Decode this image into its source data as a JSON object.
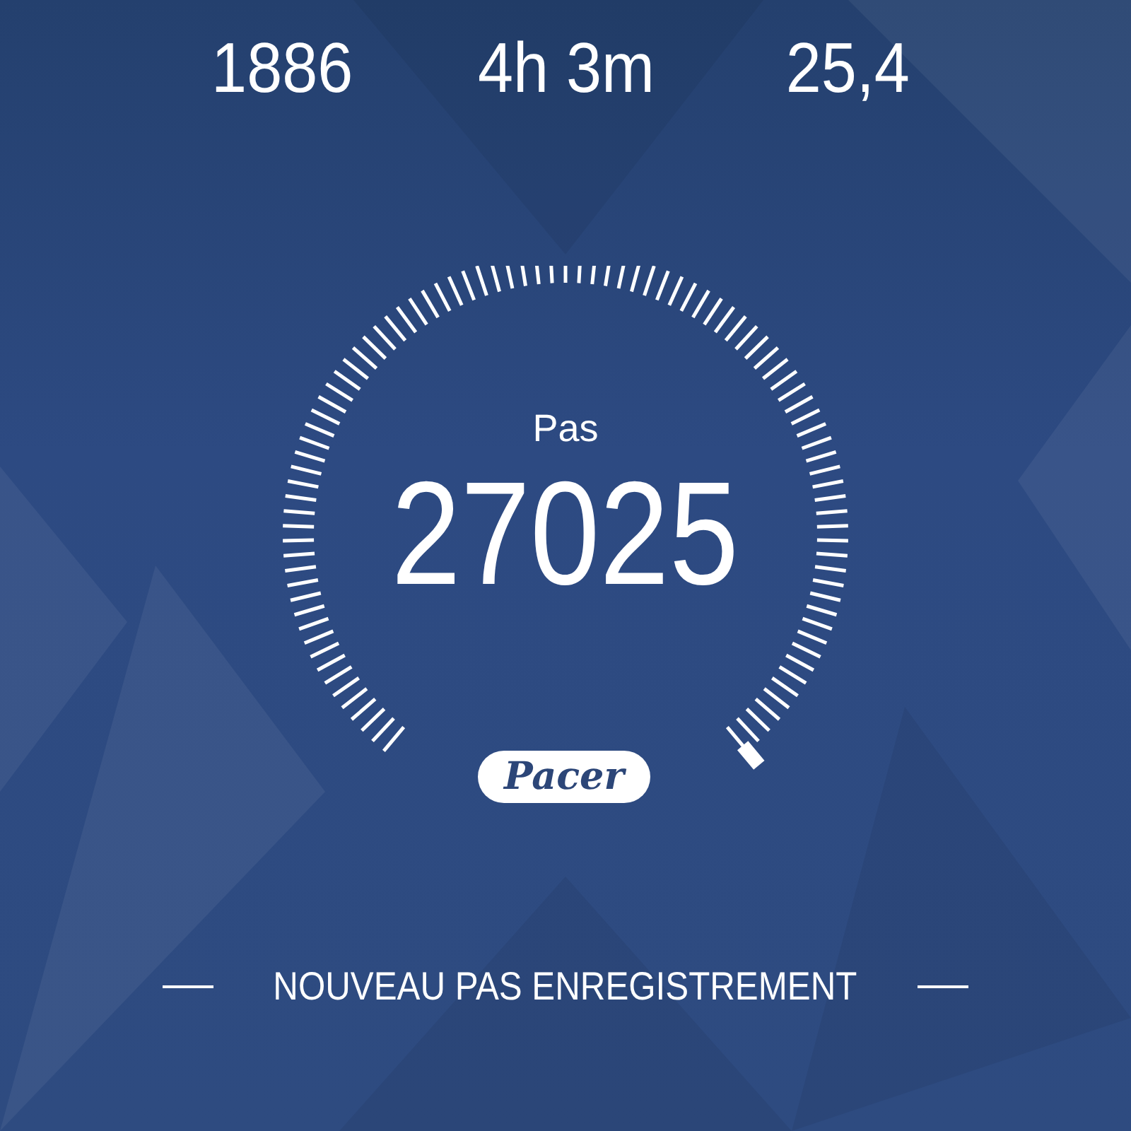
{
  "stats": [
    {
      "value": "1886"
    },
    {
      "value": "4h 3m"
    },
    {
      "value": "25,4"
    }
  ],
  "gauge": {
    "label": "Pas",
    "value": "27025"
  },
  "badge": {
    "text": "Pacer"
  },
  "footer": {
    "text": "NOUVEAU PAS ENREGISTREMENT"
  }
}
